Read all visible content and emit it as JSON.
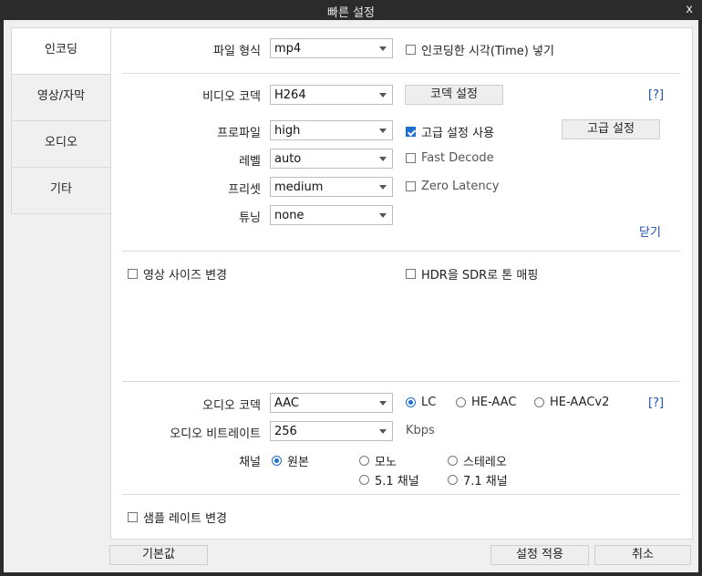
{
  "window": {
    "title": "빠른 설정",
    "close_label": "x"
  },
  "sidebar": {
    "items": [
      {
        "label": "인코딩"
      },
      {
        "label": "영상/자막"
      },
      {
        "label": "오디오"
      },
      {
        "label": "기타"
      }
    ]
  },
  "general": {
    "file_format_label": "파일 형식",
    "file_format_value": "mp4",
    "insert_time_label": "인코딩한 시각(Time) 넣기"
  },
  "video": {
    "codec_label": "비디오 코덱",
    "codec_value": "H264",
    "codec_settings_button": "코덱 설정",
    "help_link": "[?]",
    "profile_label": "프로파일",
    "profile_value": "high",
    "use_advanced_label": "고급 설정 사용",
    "advanced_button": "고급 설정",
    "level_label": "레벨",
    "level_value": "auto",
    "fast_decode_label": "Fast Decode",
    "preset_label": "프리셋",
    "preset_value": "medium",
    "zero_latency_label": "Zero Latency",
    "tuning_label": "튜닝",
    "tuning_value": "none",
    "close_link": "닫기",
    "resize_label": "영상 사이즈 변경",
    "hdr_label": "HDR을 SDR로 톤 매핑"
  },
  "audio": {
    "codec_label": "오디오 코덱",
    "codec_value": "AAC",
    "lc_label": "LC",
    "heaac_label": "HE-AAC",
    "heaacv2_label": "HE-AACv2",
    "help_link": "[?]",
    "bitrate_label": "오디오 비트레이트",
    "bitrate_value": "256",
    "bitrate_unit": "Kbps",
    "channel_label": "채널",
    "ch_original": "원본",
    "ch_mono": "모노",
    "ch_stereo": "스테레오",
    "ch_51": "5.1 채널",
    "ch_71": "7.1 채널",
    "samplerate_label": "샘플 레이트 변경"
  },
  "footer": {
    "default_button": "기본값",
    "apply_button": "설정 적용",
    "cancel_button": "취소"
  },
  "colors": {
    "accent": "#1f6fd1",
    "titlebar": "#2b2b2b",
    "link": "#1c4fb1"
  }
}
